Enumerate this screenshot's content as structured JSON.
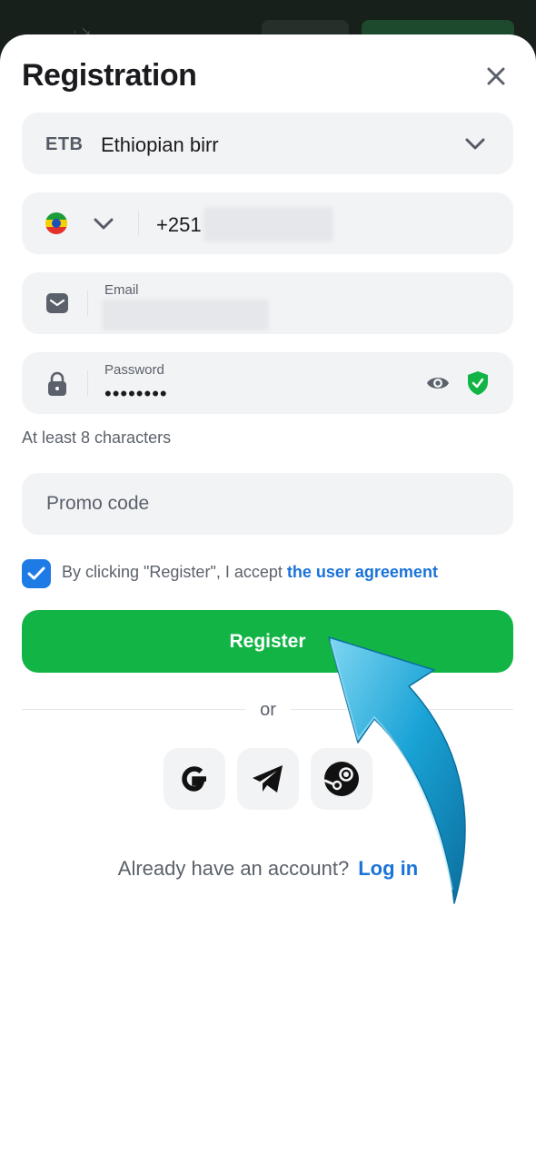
{
  "modal": {
    "title": "Registration"
  },
  "currency": {
    "code": "ETB",
    "name": "Ethiopian birr"
  },
  "phone": {
    "prefix": "+251"
  },
  "email": {
    "label": "Email"
  },
  "password": {
    "label": "Password",
    "value": "••••••••",
    "hint": "At least 8 characters"
  },
  "promo": {
    "placeholder": "Promo code"
  },
  "agreement": {
    "checked": true,
    "text": "By clicking \"Register\", I accept ",
    "link": "the user agreement"
  },
  "register_label": "Register",
  "divider_text": "or",
  "login": {
    "prompt": "Already have an account?",
    "link": "Log in"
  },
  "colors": {
    "primary_green": "#12b545",
    "link_blue": "#1a73d8",
    "field_bg": "#f2f3f5",
    "shield_green": "#12b545",
    "annotation_arrow": "#1aa3d6"
  },
  "icons": [
    "close-icon",
    "chevron-down-icon",
    "ethiopia-flag-icon",
    "mail-icon",
    "lock-icon",
    "eye-icon",
    "shield-check-icon",
    "check-icon",
    "google-icon",
    "telegram-icon",
    "steam-icon",
    "arrow-annotation"
  ]
}
